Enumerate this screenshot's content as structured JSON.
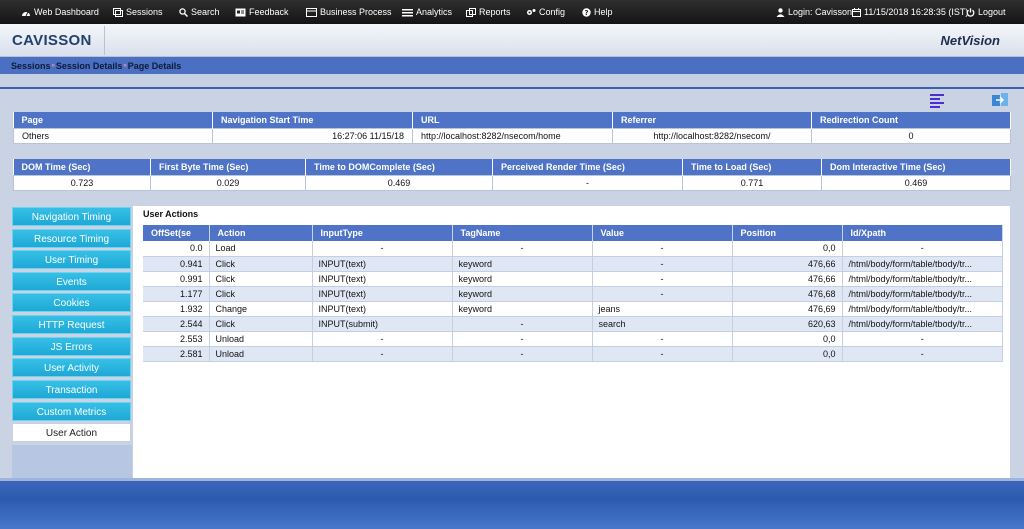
{
  "topbar": {
    "items": [
      {
        "label": "Web Dashboard",
        "icon": "dashboard-icon"
      },
      {
        "label": "Sessions",
        "icon": "sessions-icon"
      },
      {
        "label": "Search",
        "icon": "search-icon"
      },
      {
        "label": "Feedback",
        "icon": "feedback-icon"
      },
      {
        "label": "Business Process",
        "icon": "business-process-icon"
      },
      {
        "label": "Analytics",
        "icon": "analytics-icon"
      },
      {
        "label": "Reports",
        "icon": "reports-icon"
      },
      {
        "label": "Config",
        "icon": "config-icon"
      },
      {
        "label": "Help",
        "icon": "help-icon"
      }
    ],
    "login": "Login: Cavisson",
    "datetime": "11/15/2018 16:28:35 (IST)",
    "logout": "Logout"
  },
  "header": {
    "logo": "CAVISSON",
    "product": "NetVision"
  },
  "breadcrumb": {
    "items": [
      "Sessions",
      "Session Details",
      "Page Details"
    ],
    "separator": "»"
  },
  "page_info": {
    "headers": [
      "Page",
      "Navigation Start Time",
      "URL",
      "Referrer",
      "Redirection Count"
    ],
    "values": [
      "Others",
      "16:27:06 11/15/18",
      "http://localhost:8282/nsecom/home",
      "http://localhost:8282/nsecom/",
      "0"
    ]
  },
  "timing_info": {
    "headers": [
      "DOM Time (Sec)",
      "First Byte Time (Sec)",
      "Time to DOMComplete (Sec)",
      "Perceived Render Time (Sec)",
      "Time to Load (Sec)",
      "Dom Interactive Time (Sec)"
    ],
    "values": [
      "0.723",
      "0.029",
      "0.469",
      "-",
      "0.771",
      "0.469"
    ]
  },
  "sidebar": {
    "items": [
      "Navigation Timing",
      "Resource Timing",
      "User Timing",
      "Events",
      "Cookies",
      "HTTP Request",
      "JS Errors",
      "User Activity",
      "Transaction",
      "Custom Metrics",
      "User Action"
    ],
    "active": "User Action"
  },
  "user_actions": {
    "title": "User Actions",
    "headers": [
      "OffSet(se",
      "Action",
      "InputType",
      "TagName",
      "Value",
      "Position",
      "Id/Xpath"
    ],
    "rows": [
      [
        "0.0",
        "Load",
        "-",
        "-",
        "-",
        "0,0",
        "-"
      ],
      [
        "0.941",
        "Click",
        "INPUT(text)",
        "keyword",
        "-",
        "476,66",
        "/html/body/form/table/tbody/tr..."
      ],
      [
        "0.991",
        "Click",
        "INPUT(text)",
        "keyword",
        "-",
        "476,66",
        "/html/body/form/table/tbody/tr..."
      ],
      [
        "1.177",
        "Click",
        "INPUT(text)",
        "keyword",
        "-",
        "476,68",
        "/html/body/form/table/tbody/tr..."
      ],
      [
        "1.932",
        "Change",
        "INPUT(text)",
        "keyword",
        "jeans",
        "476,69",
        "/html/body/form/table/tbody/tr..."
      ],
      [
        "2.544",
        "Click",
        "INPUT(submit)",
        "-",
        "search",
        "620,63",
        "/html/body/form/table/tbody/tr..."
      ],
      [
        "2.553",
        "Unload",
        "-",
        "-",
        "-",
        "0,0",
        "-"
      ],
      [
        "2.581",
        "Unload",
        "-",
        "-",
        "-",
        "0,0",
        "-"
      ]
    ]
  },
  "colors": {
    "accent": "#4f73c6",
    "sidebar_button": "#29b4de",
    "topbar": "#1e1e1e"
  }
}
